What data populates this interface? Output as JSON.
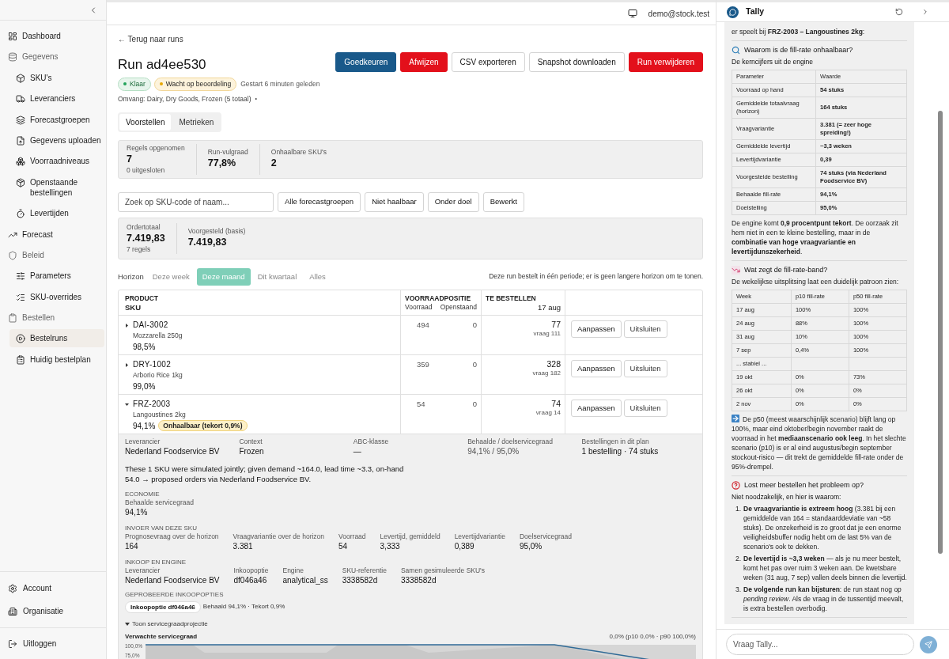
{
  "sidebar": {
    "items": [
      {
        "label": "Dashboard",
        "kind": "link",
        "selected": false
      },
      {
        "label": "Gegevens",
        "kind": "group",
        "children": [
          {
            "label": "SKU's",
            "selected": false
          },
          {
            "label": "Leveranciers",
            "selected": false
          },
          {
            "label": "Forecastgroepen",
            "selected": false
          },
          {
            "label": "Gegevens uploaden",
            "selected": false
          },
          {
            "label": "Voorraadniveaus",
            "selected": false
          },
          {
            "label": "Openstaande bestellingen",
            "selected": false
          },
          {
            "label": "Levertijden",
            "selected": false
          }
        ]
      },
      {
        "label": "Forecast",
        "kind": "link",
        "selected": false
      },
      {
        "label": "Beleid",
        "kind": "group",
        "children": [
          {
            "label": "Parameters",
            "selected": false
          },
          {
            "label": "SKU-overrides",
            "selected": false
          }
        ]
      },
      {
        "label": "Bestellen",
        "kind": "group",
        "children": [
          {
            "label": "Bestelruns",
            "selected": true
          },
          {
            "label": "Huidig bestelplan",
            "selected": false
          }
        ]
      }
    ],
    "footer": [
      "Account",
      "Organisatie"
    ],
    "logout": "Uitloggen"
  },
  "header": {
    "user": "demo@stock.test"
  },
  "main": {
    "back_link": "← Terug naar runs",
    "title": "Run ad4ee530",
    "actions": [
      {
        "label": "Goedkeuren",
        "kind": "primary"
      },
      {
        "label": "Afwijzen",
        "kind": "danger"
      },
      {
        "label": "CSV exporteren",
        "kind": "secondary"
      },
      {
        "label": "Snapshot downloaden",
        "kind": "secondary"
      },
      {
        "label": "Run verwijderen",
        "kind": "danger"
      }
    ],
    "badges": [
      {
        "label": "Klaar",
        "kind": "success"
      },
      {
        "label": "Wacht op beoordeling",
        "kind": "warning"
      }
    ],
    "started": "Gestart 6 minuten geleden",
    "scope": "Omvang: Dairy, Dry Goods, Frozen (5 totaal)",
    "scope_separator": "•",
    "tabs": [
      {
        "label": "Voorstellen",
        "selected": true
      },
      {
        "label": "Metrieken",
        "selected": false
      }
    ],
    "stats": [
      {
        "label": "Regels opgenomen",
        "value": "7",
        "note": "0 uitgesloten"
      },
      {
        "label": "Run-vulgraad",
        "value": "77,8%"
      },
      {
        "label": "Onhaalbare SKU's",
        "value": "2"
      }
    ],
    "search": {
      "placeholder": "Zoek op SKU-code of naam..."
    },
    "filters": [
      {
        "label": "Alle forecastgroepen",
        "selected": false
      },
      {
        "label": "Niet haalbaar",
        "selected": false
      },
      {
        "label": "Onder doel",
        "selected": false
      },
      {
        "label": "Bewerkt",
        "selected": false
      }
    ],
    "totals": [
      {
        "label": "Ordertotaal",
        "value": "7.419,83",
        "note": "7 regels"
      },
      {
        "label": "Voorgesteld (basis)",
        "value": "7.419,83"
      }
    ],
    "horizon": {
      "label": "Horizon",
      "options": [
        {
          "label": "Deze week",
          "selected": false
        },
        {
          "label": "Deze maand",
          "selected": true
        },
        {
          "label": "Dit kwartaal",
          "selected": false
        },
        {
          "label": "Alles",
          "selected": false
        }
      ],
      "note": "Deze run bestelt in één periode; er is geen langere horizon om te tonen."
    },
    "table": {
      "columns": {
        "product": "PRODUCT",
        "sku": "SKU",
        "position": "VOORRAADPOSITIE",
        "stock": "Voorraad",
        "open": "Openstaand",
        "order": "TE BESTELLEN",
        "date": "17 aug"
      },
      "rows": [
        {
          "sku": "DAI-3002",
          "name": "Mozzarella 250g",
          "fill_rate": "98,5%",
          "expanded": false,
          "stock": "494",
          "open": "0",
          "order": "77",
          "demand": "vraag 111",
          "actions": [
            "Aanpassen",
            "Uitsluiten"
          ]
        },
        {
          "sku": "DRY-1002",
          "name": "Arborio Rice 1kg",
          "fill_rate": "99,0%",
          "expanded": false,
          "stock": "359",
          "open": "0",
          "order": "328",
          "demand": "vraag 182",
          "actions": [
            "Aanpassen",
            "Uitsluiten"
          ]
        },
        {
          "sku": "FRZ-2003",
          "name": "Langoustines 2kg",
          "fill_rate": "94,1%",
          "badge": "Onhaalbaar (tekort 0,9%)",
          "expanded": true,
          "stock": "54",
          "open": "0",
          "order": "74",
          "demand": "vraag 14",
          "actions": [
            "Aanpassen",
            "Uitsluiten"
          ]
        }
      ]
    },
    "detail": {
      "summary": [
        {
          "label": "Leverancier",
          "value": "Nederland Foodservice BV"
        },
        {
          "label": "Context",
          "value": "Frozen"
        },
        {
          "label": "ABC-klasse",
          "value": "—"
        },
        {
          "label": "Behaalde / doelservicegraad",
          "value": "94,1% / 95,0%"
        },
        {
          "label": "Bestellingen in dit plan",
          "value": "1 bestelling · 74 stuks"
        }
      ],
      "explanation": "These 1 SKU were simulated jointly; given demand ~164.0, lead time ~3.3, on-hand 54.0 → proposed orders via Nederland Foodservice BV.",
      "sections": [
        {
          "title": "ECONOMIE",
          "fields": [
            {
              "label": "Behaalde servicegraad",
              "value": "94,1%"
            }
          ]
        },
        {
          "title": "INVOER VAN DEZE SKU",
          "fields": [
            {
              "label": "Prognosevraag over de horizon",
              "value": "164"
            },
            {
              "label": "Vraagvariantie over de horizon",
              "value": "3.381"
            },
            {
              "label": "Voorraad",
              "value": "54"
            },
            {
              "label": "Levertijd, gemiddeld",
              "value": "3,333"
            },
            {
              "label": "Levertijdvariantie",
              "value": "0,389"
            },
            {
              "label": "Doelservicegraad",
              "value": "95,0%"
            }
          ]
        },
        {
          "title": "INKOOP EN ENGINE",
          "fields": [
            {
              "label": "Leverancier",
              "value": "Nederland Foodservice BV"
            },
            {
              "label": "Inkoopoptie",
              "value": "df046a46"
            },
            {
              "label": "Engine",
              "value": "analytical_ss"
            },
            {
              "label": "SKU-referentie",
              "value": "3338582d"
            },
            {
              "label": "Samen gesimuleerde SKU's",
              "value": "3338582d"
            }
          ]
        }
      ],
      "options": {
        "title": "GEPROBEERDE INKOOPOPTIES",
        "chip": "Inkoopoptie df046a46",
        "result": "Behaald 94,1% · Tekort 0,9%"
      },
      "projection": {
        "toggle": "Toon servicegraadprojectie",
        "expanded": true,
        "title": "Verwachte servicegraad",
        "summary": "0,0% (p10 0,0% · p90 100,0%)",
        "ticks": [
          "100,0%",
          "75,0%"
        ]
      }
    }
  },
  "chat": {
    "title": "Tally",
    "blocks": [
      {
        "kind": "text",
        "text": "er speelt bij **FRZ-2003 – Langoustines 2kg**:"
      },
      {
        "kind": "divider"
      },
      {
        "kind": "heading_search",
        "text": "Waarom is de fill-rate onhaalbaar?"
      },
      {
        "kind": "subheading",
        "text": "De kerncijfers uit de engine"
      },
      {
        "kind": "table",
        "bold_values": true,
        "header": [
          "Parameter",
          "Waarde"
        ],
        "rows": [
          [
            "Voorraad op hand",
            "54 stuks"
          ],
          [
            "Gemiddelde totaalvraag (horizon)",
            "164 stuks"
          ],
          [
            "Vraagvariantie",
            "3.381 (= zeer hoge spreiding!)"
          ],
          [
            "Gemiddelde levertijd",
            "~3,3 weken"
          ],
          [
            "Levertijdvariantie",
            "0,39"
          ],
          [
            "Voorgestelde bestelling",
            "74 stuks (via Nederland Foodservice BV)"
          ],
          [
            "Behaalde fill-rate",
            "94,1%"
          ],
          [
            "Doelstelling",
            "95,0%"
          ]
        ]
      },
      {
        "kind": "text",
        "text": "De engine komt **0,9 procentpunt tekort**. De oorzaak zit hem niet in een te kleine bestelling, maar in de **combinatie van hoge vraagvariantie en levertijdunszekerheid**."
      },
      {
        "kind": "divider"
      },
      {
        "kind": "heading_chart",
        "text": "Wat zegt de fill-rate-band?"
      },
      {
        "kind": "text",
        "text": "De wekelijkse uitsplitsing laat een duidelijk patroon zien:"
      },
      {
        "kind": "table",
        "bold_values": false,
        "header": [
          "Week",
          "p10 fill-rate",
          "p50 fill-rate"
        ],
        "rows": [
          [
            "17 aug",
            "100%",
            "100%"
          ],
          [
            "24 aug",
            "88%",
            "100%"
          ],
          [
            "31 aug",
            "10%",
            "100%"
          ],
          [
            "7 sep",
            "0,4%",
            "100%"
          ],
          [
            "... stabiel ..."
          ],
          [
            "19 okt",
            "0%",
            "73%"
          ],
          [
            "26 okt",
            "0%",
            "0%"
          ],
          [
            "2 nov",
            "0%",
            "0%"
          ]
        ]
      },
      {
        "kind": "text_arrow",
        "text": "De p50 (meest waarschijnlijk scenario) blijft lang op 100%, maar eind oktober/begin november raakt de voorraad in het **mediaanscenario ook leeg**. In het slechte scenario (p10) is er al eind augustus/begin september stockout-risico — dit trekt de gemiddelde fill-rate onder de 95%-drempel."
      },
      {
        "kind": "divider"
      },
      {
        "kind": "heading_question",
        "text": "Lost meer bestellen het probleem op?"
      },
      {
        "kind": "subheading",
        "text": "Niet noodzakelijk, en hier is waarom:"
      },
      {
        "kind": "list",
        "items": [
          {
            "marker": "1.",
            "text": "**De vraagvariantie is extreem hoog** (3.381 bij een gemiddelde van 164 = standaarddeviatie van ~58 stuks). De onzekerheid is zo groot dat je een enorme veiligheidsbuffer nodig hebt om de last 5% van de scenario's ook te dekken."
          },
          {
            "marker": "2.",
            "text": "**De levertijd is ~3,3 weken** — als je nu meer bestelt, komt het pas over ruim 3 weken aan. De kwetsbare weken (31 aug, 7 sep) vallen deels binnen die levertijd."
          },
          {
            "marker": "3.",
            "text": "**De volgende run kan bijsturen**: de run staat nog op *pending review*. Als de vraag in de tussentijd meevalt, is extra bestellen overbodig."
          }
        ]
      },
      {
        "kind": "divider"
      }
    ],
    "input": {
      "placeholder": "Vraag Tally..."
    }
  }
}
